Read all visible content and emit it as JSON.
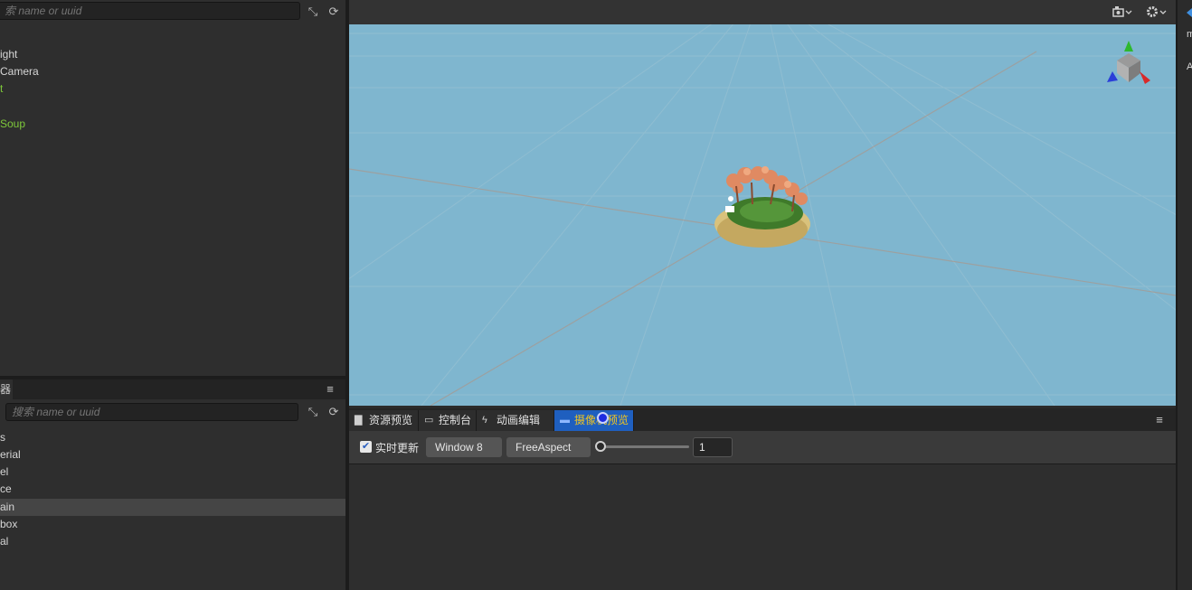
{
  "hierarchy": {
    "search_placeholder": "搜索 name or uuid",
    "search_visible": "索 name or uuid",
    "items": [
      {
        "label": "ight",
        "color": "#e6e6e6"
      },
      {
        "label": "Camera",
        "color": "#e6e6e6"
      },
      {
        "label": "t",
        "color": "#e6e6e6"
      },
      {
        "label": "Soup",
        "color": "#7ec83a"
      }
    ]
  },
  "assets": {
    "tab_label": "器",
    "search_placeholder": "搜索 name or uuid",
    "items": [
      {
        "label": "s"
      },
      {
        "label": "erial"
      },
      {
        "label": "el"
      },
      {
        "label": "ce"
      },
      {
        "label": "ain",
        "selected": true
      },
      {
        "label": "box"
      },
      {
        "label": "al"
      }
    ]
  },
  "scene_toolbar": {
    "camera_icon": "camera-icon",
    "settings_icon": "gear-icon"
  },
  "bottom_tabs": [
    {
      "label": "资源预览",
      "icon": "folder-icon"
    },
    {
      "label": "控制台",
      "icon": "console-icon"
    },
    {
      "label": "动画编辑器",
      "icon": "animation-icon"
    },
    {
      "label": "摄像机预览",
      "icon": "camera-preview-icon",
      "active": true
    }
  ],
  "preview_toolbar": {
    "realtime_label": "实时更新",
    "realtime_checked": true,
    "window_select": "Window 8",
    "aspect_select": "FreeAspect",
    "zoom_value": "1",
    "zoom_fraction": 0.0
  },
  "right_strip": {
    "letters": [
      "m",
      "A"
    ]
  },
  "colors": {
    "scene_bg": "#7fb6cf",
    "accent": "#1f5fbf",
    "active_tab_text": "#f0c420",
    "node_highlight": "#7ec83a"
  }
}
